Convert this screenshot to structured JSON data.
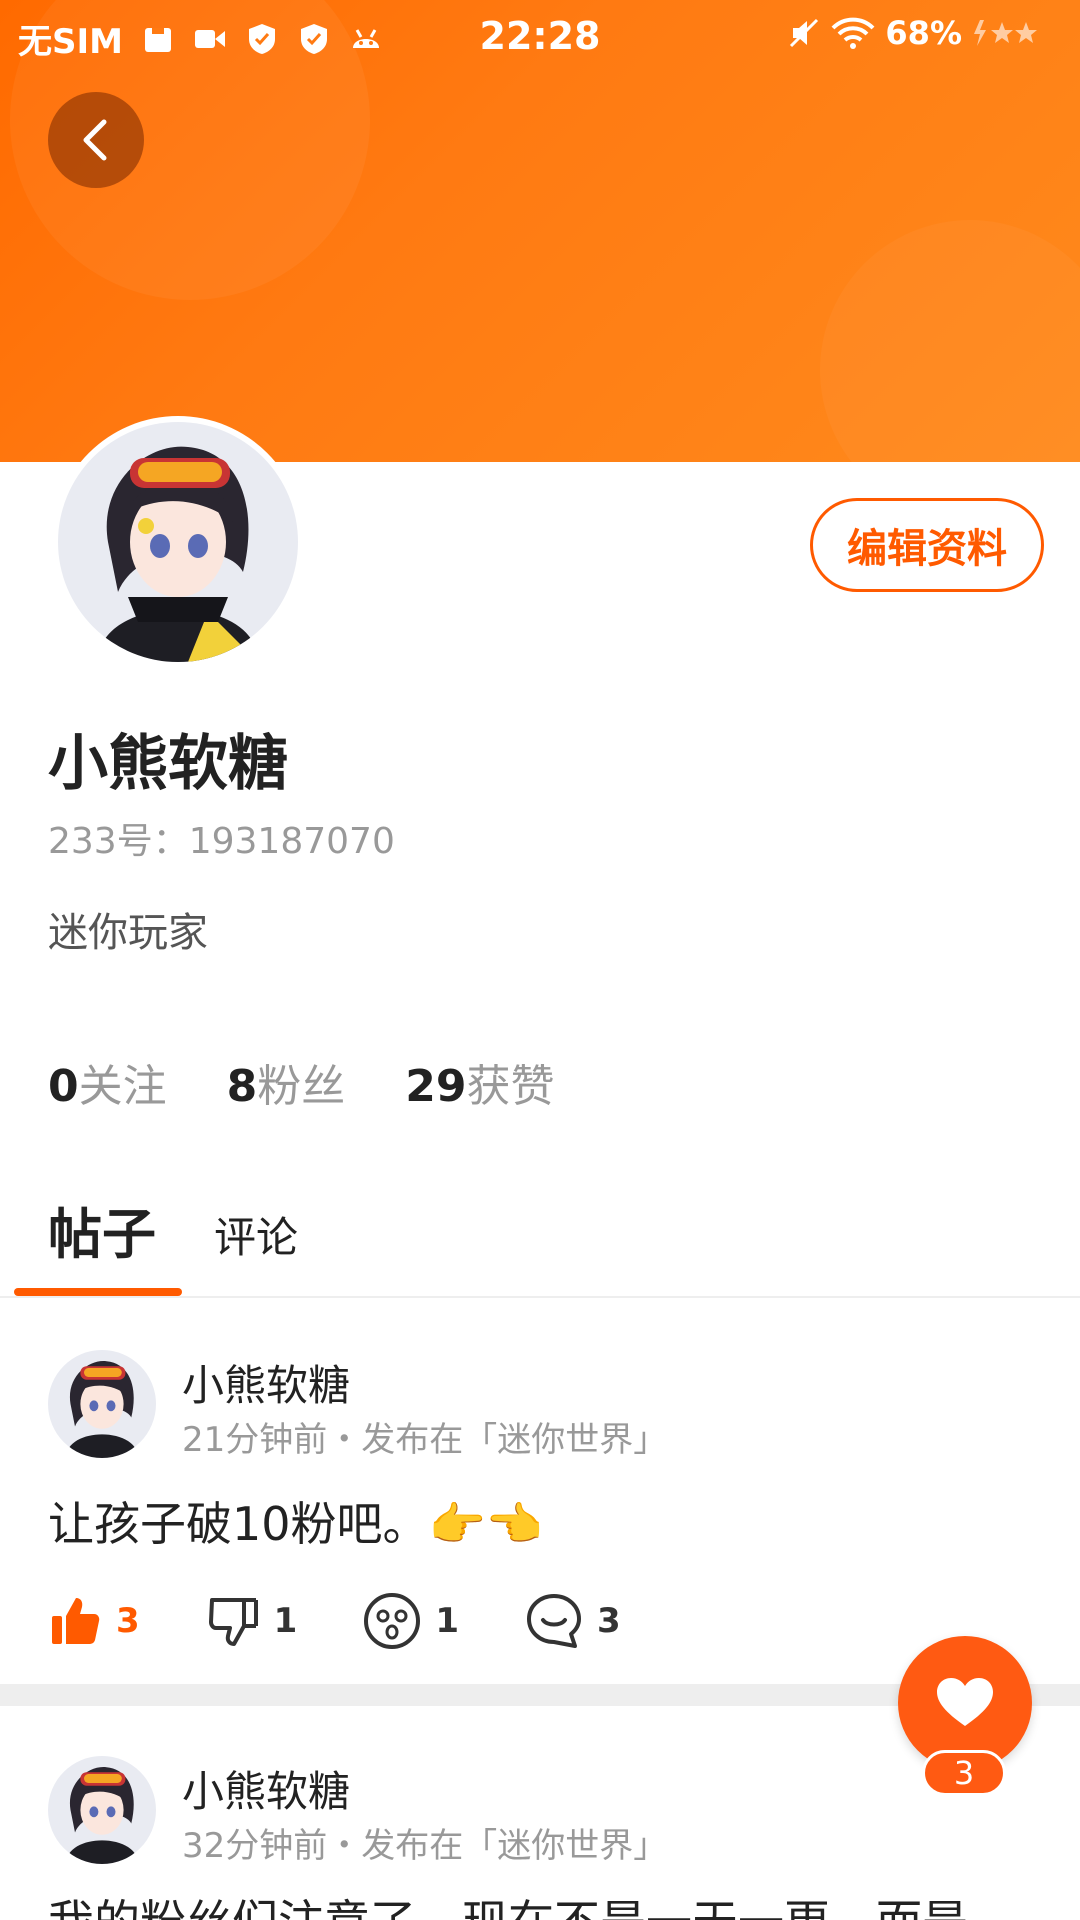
{
  "status_bar": {
    "carrier": "无SIM",
    "time": "22:28",
    "battery": "68%"
  },
  "profile": {
    "name": "小熊软糖",
    "uid": "233号：193187070",
    "bio": "迷你玩家",
    "edit_label": "编辑资料",
    "stats": [
      {
        "num": "0",
        "label": "关注"
      },
      {
        "num": "8",
        "label": "粉丝"
      },
      {
        "num": "29",
        "label": "获赞"
      }
    ]
  },
  "tabs": {
    "posts": "帖子",
    "comments": "评论"
  },
  "posts": [
    {
      "author": "小熊软糖",
      "meta": "21分钟前・发布在「迷你世界」",
      "text": "让孩子破10粉吧。👉👈",
      "likes": "3",
      "dislikes": "1",
      "reactions": "1",
      "comments": "3"
    },
    {
      "author": "小熊软糖",
      "meta": "32分钟前・发布在「迷你世界」",
      "text": "我的粉丝们注意了，现在不是一天一更，而是"
    }
  ],
  "fab": {
    "count": "3"
  },
  "colors": {
    "accent": "#ff5a00",
    "banner": "#ff7a12"
  }
}
